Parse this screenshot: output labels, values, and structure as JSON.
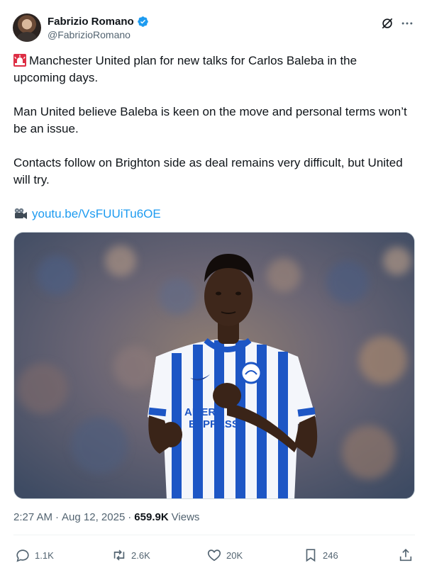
{
  "author": {
    "name": "Fabrizio Romano",
    "handle": "@FabrizioRomano"
  },
  "tweet": {
    "paragraph1": "Manchester United plan for new talks for Carlos Baleba in the upcoming days.",
    "paragraph2": "Man United believe Baleba is keen on the move and personal terms won’t be an issue.",
    "paragraph3": "Contacts follow on Brighton side as deal remains very difficult, but United will try.",
    "link": "youtu.be/VsFUUiTu6OE"
  },
  "image": {
    "shirt_sponsor_line1": "AMERI",
    "shirt_sponsor_line2": "EXPRESS"
  },
  "meta": {
    "time": "2:27 AM",
    "separator1": "·",
    "date": "Aug 12, 2025",
    "separator2": "·",
    "views_count": "659.9K",
    "views_label": "Views"
  },
  "actions": {
    "replies": "1.1K",
    "reposts": "2.6K",
    "likes": "20K",
    "bookmarks": "246"
  },
  "colors": {
    "link": "#1d9bf0",
    "verified": "#1d9bf0",
    "muted": "#536471",
    "text": "#0f1419"
  }
}
